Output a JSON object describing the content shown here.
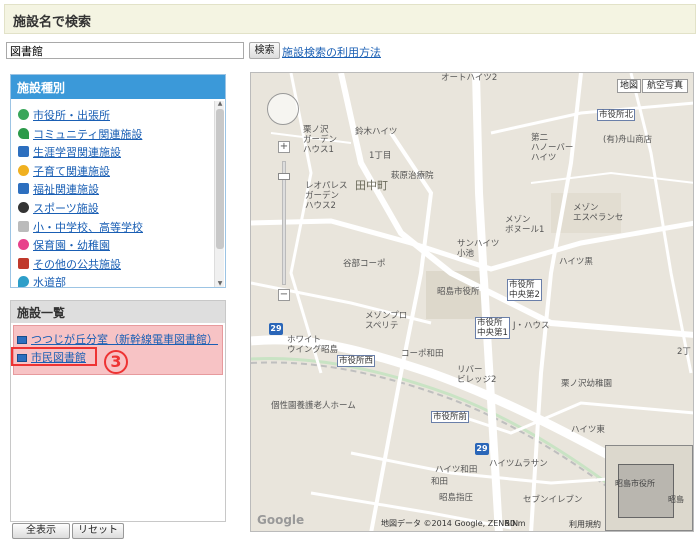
{
  "header": {
    "title": "施設名で検索"
  },
  "search": {
    "value": "図書館",
    "button_label": "検索",
    "help_link": "施設検索の利用方法"
  },
  "categories": {
    "title": "施設種別",
    "items": [
      {
        "label": "市役所・出張所",
        "color": "#3aa65a"
      },
      {
        "label": "コミュニティ関連施設",
        "color": "#2c9a4a"
      },
      {
        "label": "生涯学習関連施設",
        "color": "#2d6fbf"
      },
      {
        "label": "子育て関連施設",
        "color": "#f0b020"
      },
      {
        "label": "福祉関連施設",
        "color": "#2d6fbf"
      },
      {
        "label": "スポーツ施設",
        "color": "#333333"
      },
      {
        "label": "小・中学校、高等学校",
        "color": "#999999"
      },
      {
        "label": "保育園・幼稚園",
        "color": "#e8418b"
      },
      {
        "label": "その他の公共施設",
        "color": "#c0392b"
      },
      {
        "label": "水道部",
        "color": "#2d9ec9"
      }
    ]
  },
  "facility_list": {
    "title": "施設一覧",
    "items": [
      "つつじが丘分室（新幹線電車図書館）",
      "市民図書館"
    ],
    "callout_number": "3"
  },
  "buttons": {
    "show_all": "全表示",
    "reset": "リセット"
  },
  "map": {
    "type_map": "地図",
    "type_satellite": "航空写真",
    "zoom_in": "+",
    "zoom_out": "−",
    "labels": {
      "l1": "オートハイツ2",
      "l2": "栗ノ沢\nガーデン\nハウス1",
      "l3": "鈴木ハイツ",
      "l4": "1丁目",
      "l5": "第二\nハノーバー\nハイツ",
      "l6": "(有)舟山商店",
      "l7": "萩原治療院",
      "l8": "田中町",
      "l9": "レオパレス\nガーデン\nハウス2",
      "l10": "メゾン\nエスペランセ",
      "l11": "メゾン\nボヌール1",
      "l12": "サンハイツ\n小池",
      "l13": "谷部コーポ",
      "l14": "ハイツ黒",
      "l15": "昭島市役所",
      "l16": "メゾンプロ\nスペリテ",
      "l17": "J・ハウス",
      "l18": "ホワイト\nウイング昭島",
      "l19": "コーポ和田",
      "l20": "リバー\nビレッジ2",
      "l21": "栗ノ沢幼稚園",
      "l22": "個性園養護老人ホーム",
      "l23": "ハイツ東",
      "l24": "ハイツ和田",
      "l25": "ハイツムラサン",
      "l26": "昭島指圧",
      "l27": "セブンイレブン",
      "l28": "和田",
      "l29": "2丁"
    },
    "stations": {
      "s1": "市役所北",
      "s2": "市役所\n中央第2",
      "s3": "市役所\n中央第1",
      "s4": "市役所西",
      "s5": "市役所前"
    },
    "route": "29",
    "logo": "Google",
    "attribution": "地図データ ©2014 Google, ZENRIN",
    "scale": "50 m",
    "terms": "利用規約",
    "overview_label": "昭島市役所",
    "overview_label2": "昭島"
  }
}
